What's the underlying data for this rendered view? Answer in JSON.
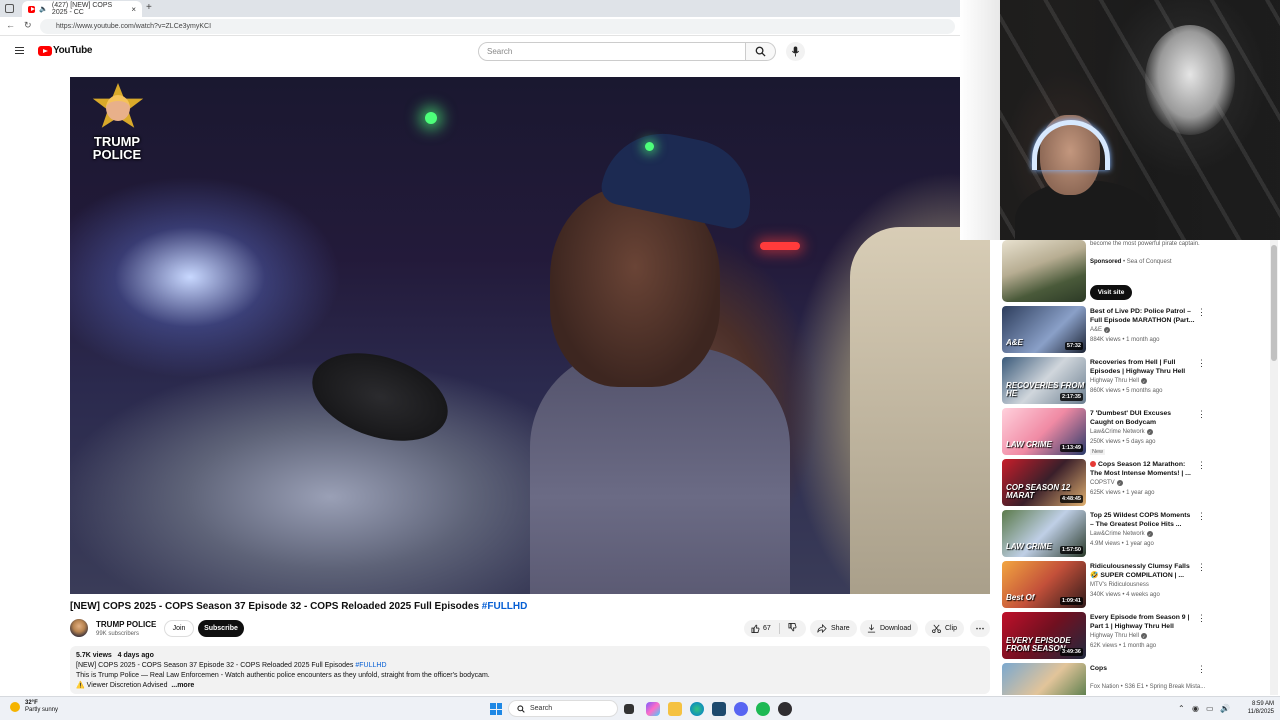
{
  "browser": {
    "tab_title": "(427) [NEW] COPS 2025 - CC",
    "new_tab": "+",
    "url": "https://www.youtube.com/watch?v=ZLCe3ymyKCI"
  },
  "header": {
    "brand": "YouTube",
    "search_placeholder": "Search"
  },
  "video": {
    "overlay_logo_text": "TRUMP\nPOLICE",
    "title": "[NEW] COPS 2025 - COPS Season 37 Episode 32 - COPS Reloaded 2025 Full Episodes",
    "title_tag": "#FULLHD"
  },
  "channel": {
    "name": "TRUMP POLICE",
    "subscribers": "99K subscribers",
    "join_label": "Join",
    "subscribe_label": "Subscribe"
  },
  "actions": {
    "like_count": "67",
    "share_label": "Share",
    "download_label": "Download",
    "clip_label": "Clip"
  },
  "description": {
    "views": "5.7K views",
    "age": "4 days ago",
    "line1": "[NEW] COPS 2025 - COPS Season 37 Episode 32 - COPS Reloaded 2025 Full Episodes",
    "line1_tag": "#FULLHD",
    "line2": "This is Trump Police — Real Law Enforcemen - Watch authentic police encounters as they unfold, straight from the officer's bodycam.",
    "line3": "⚠️ Viewer Discretion Advised",
    "more": "...more"
  },
  "sidebar": {
    "ad": {
      "text": "become the most powerful pirate captain.",
      "sponsored": "Sponsored",
      "advertiser": "Sea of Conquest",
      "cta": "Visit site"
    },
    "items": [
      {
        "title": "Best of Live PD: Police Patrol – Full Episode MARATHON (Part...",
        "channel": "A&E",
        "verified": true,
        "meta": "884K views • 1 month ago",
        "duration": "57:32",
        "thumb_text": "A&E",
        "new": ""
      },
      {
        "title": "Recoveries from Hell | Full Episodes | Highway Thru Hell",
        "channel": "Highway Thru Hell",
        "verified": true,
        "meta": "860K views • 5 months ago",
        "duration": "2:17:35",
        "thumb_text": "RECOVERIES FROM HE",
        "new": ""
      },
      {
        "title": "7 'Dumbest' DUI Excuses Caught on Bodycam",
        "channel": "Law&Crime Network",
        "verified": true,
        "meta": "250K views • 5 days ago",
        "duration": "1:13:49",
        "thumb_text": "LAW CRIME",
        "new": "New"
      },
      {
        "title": "Cops Season 12 Marathon: The Most Intense Moments! | ...",
        "channel": "COPSTV",
        "verified": true,
        "meta": "625K views • 1 year ago",
        "duration": "4:48:45",
        "thumb_text": "COP SEASON 12 MARAT",
        "new": "",
        "live": true
      },
      {
        "title": "Top 25 Wildest COPS Moments – The Greatest Police Hits ...",
        "channel": "Law&Crime Network",
        "verified": true,
        "meta": "4.9M views • 1 year ago",
        "duration": "1:57:50",
        "thumb_text": "LAW CRIME",
        "new": ""
      },
      {
        "title": "Ridiculousnessly Clumsy Falls 🤣 SUPER COMPILATION | ...",
        "channel": "MTV's Ridiculousness",
        "verified": false,
        "meta": "340K views • 4 weeks ago",
        "duration": "1:09:41",
        "thumb_text": "Best Of",
        "new": ""
      },
      {
        "title": "Every Episode from Season 9 | Part 1 | Highway Thru Hell",
        "channel": "Highway Thru Hell",
        "verified": true,
        "meta": "62K views • 1 month ago",
        "duration": "3:49:36",
        "thumb_text": "EVERY EPISODE FROM SEASON",
        "new": ""
      },
      {
        "title": "Cops",
        "channel": "Fox Nation • S36 E1 • Spring Break Mista...",
        "verified": false,
        "meta": "",
        "duration": "",
        "thumb_text": "",
        "new": ""
      }
    ]
  },
  "taskbar": {
    "weather_temp": "32°F",
    "weather_desc": "Partly sunny",
    "search_label": "Search",
    "time": "8:59 AM",
    "date": "11/8/2025"
  },
  "colors": {
    "youtube_red": "#ff0000",
    "link_blue": "#065fd4",
    "dark": "#0f0f0f"
  }
}
